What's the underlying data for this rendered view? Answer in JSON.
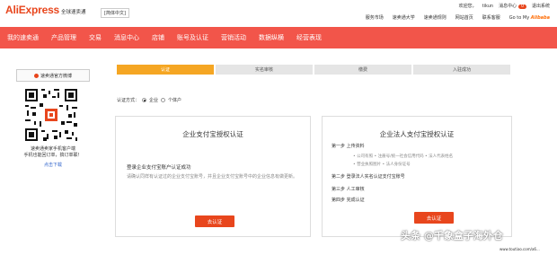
{
  "header": {
    "logo": "AliExpress",
    "logo_sub": "全球速卖通",
    "language": "[简体中文]",
    "row1": {
      "welcome": "欢迎您，",
      "user": "tikun",
      "messages_label": "消息中心",
      "messages_count": "0",
      "logout": "退出系统"
    },
    "row2": {
      "service_market": "服务市场",
      "alipay_login": "速卖通大学",
      "alipay_news": "速卖通规则",
      "nav_site": "网站首页",
      "contact": "联系客服",
      "goto_prefix": "Go to My",
      "goto_brand": "Alibaba"
    }
  },
  "nav": {
    "items": [
      "我的速卖通",
      "产品管理",
      "交易",
      "消息中心",
      "店铺",
      "账号及认证",
      "营销活动",
      "数据纵横",
      "经营表现"
    ]
  },
  "left": {
    "official_button": "速卖通官方微博",
    "qr_caption_line1": "速卖通卖家手机客户端",
    "qr_caption_line2": "手机也能回订单，搞订单联！",
    "qr_link": "点击下载"
  },
  "steps": [
    "认证",
    "实名审核",
    "缴费",
    "入驻成功"
  ],
  "auth_type": {
    "label": "认证方式：",
    "option1": "企业",
    "option2": "个体户"
  },
  "card_left": {
    "title": "企业支付宝授权认证",
    "sub": "登录企业支付宝账户认证成功",
    "desc": "请确认同样有认证过的企业支付宝账号，并且企业支付宝账号中的企业信息有做更新。",
    "button": "去认证"
  },
  "card_right": {
    "title": "企业法人支付宝授权认证",
    "step1": "第一步 上传资料",
    "bullet1": "• 公司有照 • 注册号/统一社会信用代码 • 法人代表姓名",
    "bullet2": "• 营业执照图片 • 法人身份证号",
    "step2": "第二步 登录法人实名认证支付宝账号",
    "step3": "第三步 人工审核",
    "step4": "第四步 完成认证",
    "button": "去认证"
  },
  "watermark": {
    "text": "头条 @千象盒子海外仓",
    "url": "www.toutiao.com/a6..."
  }
}
